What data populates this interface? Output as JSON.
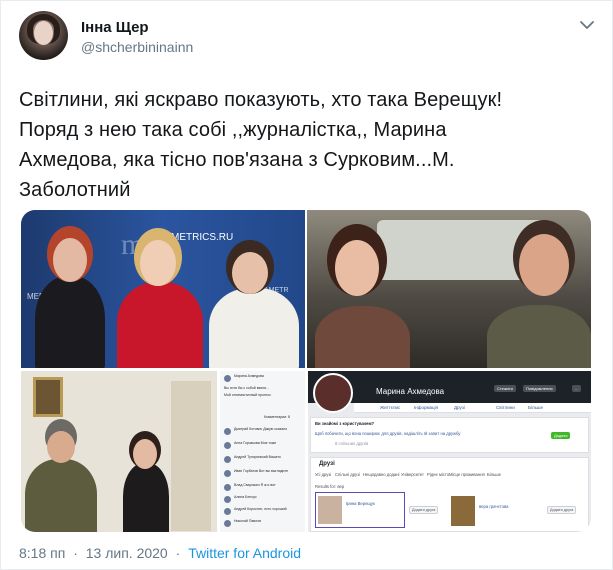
{
  "tweet": {
    "author": {
      "display_name": "Інна Щер",
      "handle": "@shcherbininainn"
    },
    "text_lines": [
      "Світлини, які яскраво показують, хто така Верещук!",
      "Поряд з нею така собі ,,журналістка,, Марина",
      "Ахмедова, яка тісно пов'язана з Сурковим...М.",
      "Заболотний"
    ],
    "time": "8:18 пп",
    "date": "13 лип. 2020",
    "separator": "·",
    "source": "Twitter for Android",
    "colors": {
      "link": "#1b95e0",
      "secondary_text": "#657786",
      "primary_text": "#14171a"
    }
  },
  "media": {
    "photo1": {
      "backdrop_text": "me",
      "url_text": "METRICS.RU",
      "watermark_left": "MEDIAM",
      "watermark_right": "DIAMETR"
    },
    "photo4": {
      "title": "Марина Ахмедова",
      "comments": [
        "Вы хотя бы с собой взяли...",
        "Мой оптимистичный прогноз",
        "Комментарии: 8",
        "Дмитрий Котович Дякую сказано",
        "Анна Горчакова Моя тоже",
        "Андрей Тупоринский Вашего",
        "Иван Горбатов Вот вы выглядите",
        "Влад Сварожич Я ж и вот",
        "Алина Белоус",
        "Андрей Коростин, есть хороший",
        "Николай Павлов"
      ]
    },
    "photo5": {
      "profile_name": "Марина Ахмедова",
      "buttons": [
        "Стежити",
        "Повідомлення",
        "..."
      ],
      "tabs": [
        "Життєпис",
        "Інформація",
        "Друзі",
        "Світлини",
        "Більше"
      ],
      "prompt_title": "Ви знайомі з користувачем?",
      "prompt_text": "Щоб побачити, що вона поширює для друзів, надішліть їй запит на дружбу",
      "mutual": "8 спільних друзів",
      "add_friend": "Додати",
      "friends_header": "Друзі",
      "friends_tabs": [
        "Усі друзі",
        "Спільні друзі",
        "Нещодавно додані",
        "Університет",
        "Рідне місто",
        "Місце проживання",
        "Більше"
      ],
      "search_label": "Results for: вер",
      "friend_cards": [
        {
          "name": "Ірина Верещук",
          "action": "Додати друга"
        },
        {
          "name": "вера грачєтова",
          "action": "Додати друга"
        }
      ]
    }
  }
}
